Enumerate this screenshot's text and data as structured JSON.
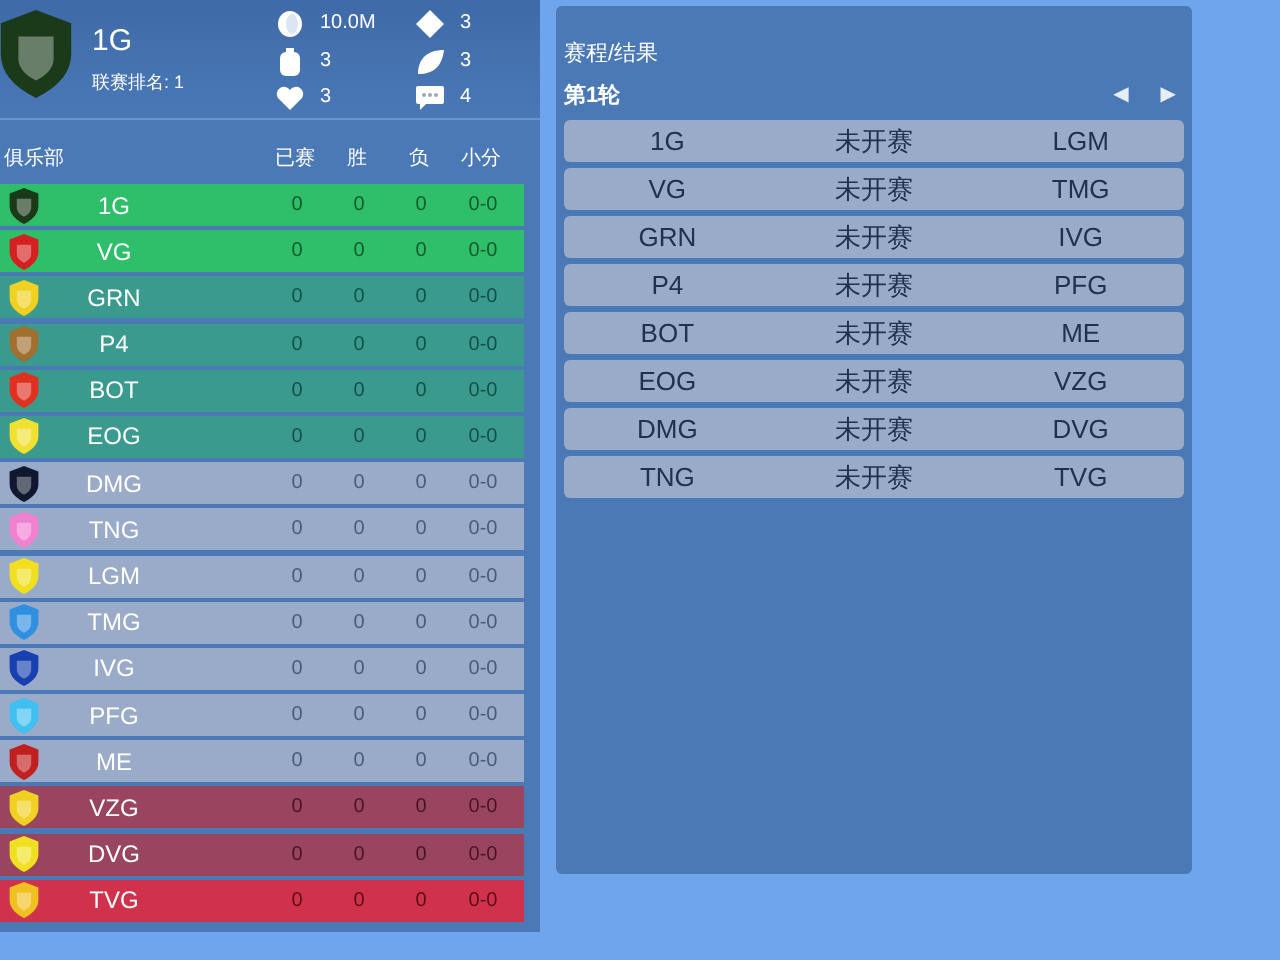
{
  "club": {
    "name": "1G",
    "rank_label": "联赛排名: 1",
    "stats": [
      {
        "kind": "coin",
        "value": "10.0M"
      },
      {
        "kind": "diamond",
        "value": "3"
      },
      {
        "kind": "bottle",
        "value": "3"
      },
      {
        "kind": "leaf",
        "value": "3"
      },
      {
        "kind": "heart",
        "value": "3"
      },
      {
        "kind": "chat",
        "value": "4"
      }
    ]
  },
  "standings": {
    "columns": [
      "俱乐部",
      "已赛",
      "胜",
      "负",
      "小分"
    ],
    "rows": [
      {
        "team": "1G",
        "kind": "promotion",
        "color": "#1a3a1a",
        "played": "0",
        "won": "0",
        "lost": "0",
        "score": "0-0"
      },
      {
        "team": "VG",
        "kind": "promotion",
        "color": "#d42020",
        "played": "0",
        "won": "0",
        "lost": "0",
        "score": "0-0"
      },
      {
        "team": "GRN",
        "kind": "playoff",
        "color": "#f0d020",
        "played": "0",
        "won": "0",
        "lost": "0",
        "score": "0-0"
      },
      {
        "team": "P4",
        "kind": "playoff",
        "color": "#a07030",
        "played": "0",
        "won": "0",
        "lost": "0",
        "score": "0-0"
      },
      {
        "team": "BOT",
        "kind": "playoff",
        "color": "#e03020",
        "played": "0",
        "won": "0",
        "lost": "0",
        "score": "0-0"
      },
      {
        "team": "EOG",
        "kind": "playoff",
        "color": "#f0e030",
        "played": "0",
        "won": "0",
        "lost": "0",
        "score": "0-0"
      },
      {
        "team": "DMG",
        "kind": "middle",
        "color": "#101830",
        "played": "0",
        "won": "0",
        "lost": "0",
        "score": "0-0"
      },
      {
        "team": "TNG",
        "kind": "middle",
        "color": "#f080d0",
        "played": "0",
        "won": "0",
        "lost": "0",
        "score": "0-0"
      },
      {
        "team": "LGM",
        "kind": "middle",
        "color": "#f0e020",
        "played": "0",
        "won": "0",
        "lost": "0",
        "score": "0-0"
      },
      {
        "team": "TMG",
        "kind": "middle",
        "color": "#3090e0",
        "played": "0",
        "won": "0",
        "lost": "0",
        "score": "0-0"
      },
      {
        "team": "IVG",
        "kind": "middle",
        "color": "#1840b0",
        "played": "0",
        "won": "0",
        "lost": "0",
        "score": "0-0"
      },
      {
        "team": "PFG",
        "kind": "middle",
        "color": "#40c0f0",
        "played": "0",
        "won": "0",
        "lost": "0",
        "score": "0-0"
      },
      {
        "team": "ME",
        "kind": "middle",
        "color": "#c02020",
        "played": "0",
        "won": "0",
        "lost": "0",
        "score": "0-0"
      },
      {
        "team": "VZG",
        "kind": "relegation",
        "color": "#f0d020",
        "played": "0",
        "won": "0",
        "lost": "0",
        "score": "0-0"
      },
      {
        "team": "DVG",
        "kind": "relegation",
        "color": "#f0e020",
        "played": "0",
        "won": "0",
        "lost": "0",
        "score": "0-0"
      },
      {
        "team": "TVG",
        "kind": "bottom",
        "color": "#f0c020",
        "played": "0",
        "won": "0",
        "lost": "0",
        "score": "0-0"
      }
    ]
  },
  "schedule": {
    "title": "赛程/结果",
    "round": "第1轮",
    "prev": "◀",
    "next": "▶",
    "matches": [
      {
        "home": "1G",
        "status": "未开赛",
        "away": "LGM"
      },
      {
        "home": "VG",
        "status": "未开赛",
        "away": "TMG"
      },
      {
        "home": "GRN",
        "status": "未开赛",
        "away": "IVG"
      },
      {
        "home": "P4",
        "status": "未开赛",
        "away": "PFG"
      },
      {
        "home": "BOT",
        "status": "未开赛",
        "away": "ME"
      },
      {
        "home": "EOG",
        "status": "未开赛",
        "away": "VZG"
      },
      {
        "home": "DMG",
        "status": "未开赛",
        "away": "DVG"
      },
      {
        "home": "TNG",
        "status": "未开赛",
        "away": "TVG"
      }
    ]
  }
}
